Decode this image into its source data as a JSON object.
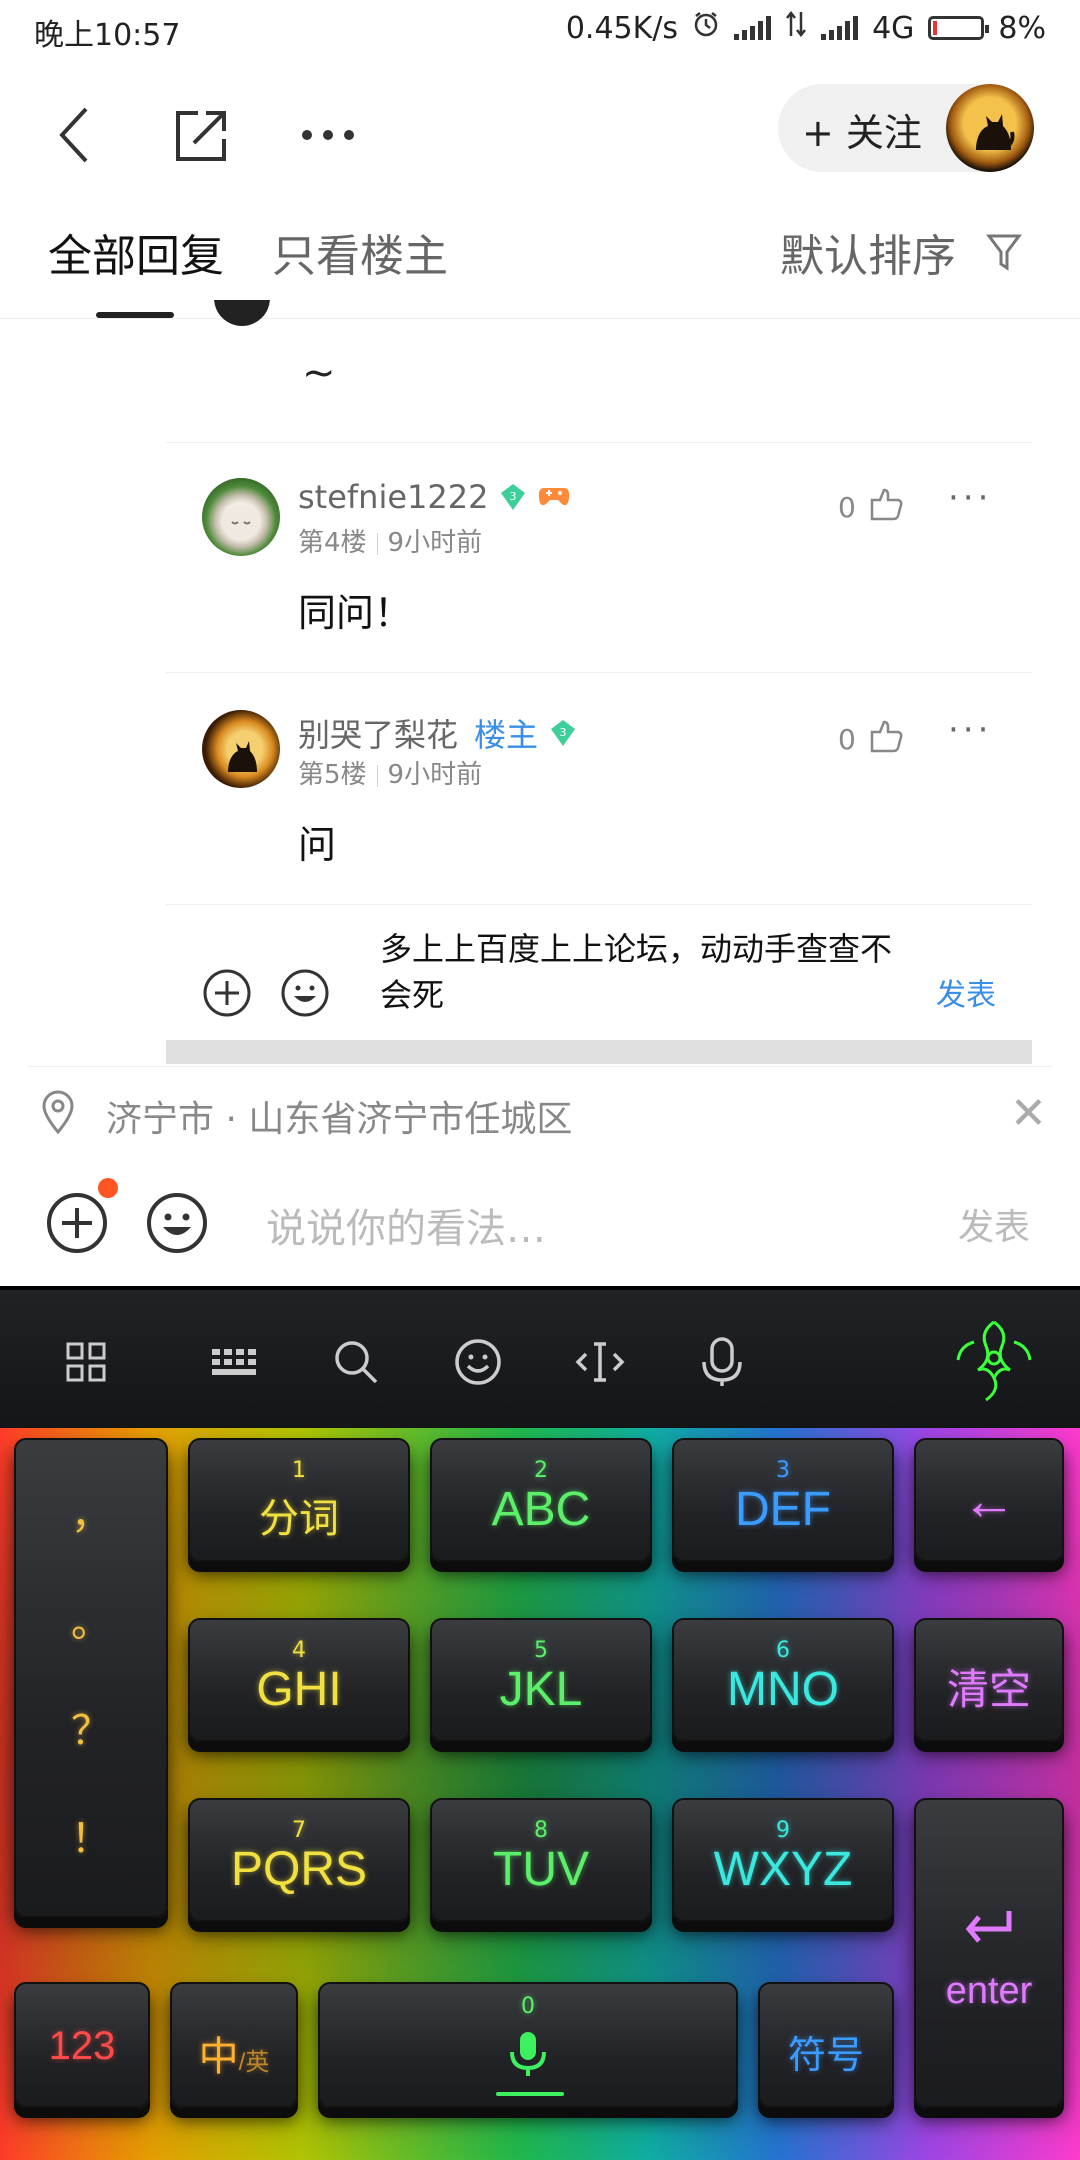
{
  "status_bar": {
    "time": "晚上10:57",
    "net_speed": "0.45K/s",
    "network_type": "4G",
    "battery": "8%",
    "battery_level": 0.08
  },
  "top_nav": {
    "follow_label": "+ 关注",
    "icons": [
      "back-icon",
      "share-icon",
      "more-icon"
    ]
  },
  "tabs": {
    "all_replies": "全部回复",
    "owner_only": "只看楼主",
    "sort": "默认排序"
  },
  "partial_reply": {
    "text": "~"
  },
  "replies": [
    {
      "username": "stefnie1222",
      "level": "3",
      "floor": "第4楼",
      "time": "9小时前",
      "likes": "0",
      "text": "同问！"
    },
    {
      "username": "别哭了梨花",
      "badge": "楼主",
      "level": "3",
      "floor": "第5楼",
      "time": "9小时前",
      "likes": "0",
      "text": "问"
    }
  ],
  "inner_reply": {
    "text": "多上上百度上上论坛，动动手查查不会死",
    "send_label": "发表"
  },
  "location": {
    "text": "济宁市 · 山东省济宁市任城区"
  },
  "main_input": {
    "placeholder": "说说你的看法…",
    "send_label": "发表"
  },
  "keyboard": {
    "toolbar_icons": [
      "grid-icon",
      "keyboard-icon",
      "search-icon",
      "emoji-icon",
      "cursor-icon",
      "mic-icon",
      "razer-logo-icon"
    ],
    "punctuation": [
      "，",
      "。",
      "？",
      "！"
    ],
    "keys": [
      {
        "num": "1",
        "label": "分词"
      },
      {
        "num": "2",
        "label": "ABC"
      },
      {
        "num": "3",
        "label": "DEF"
      },
      {
        "num": "4",
        "label": "GHI"
      },
      {
        "num": "5",
        "label": "JKL"
      },
      {
        "num": "6",
        "label": "MNO"
      },
      {
        "num": "7",
        "label": "PQRS"
      },
      {
        "num": "8",
        "label": "TUV"
      },
      {
        "num": "9",
        "label": "WXYZ"
      }
    ],
    "backspace": "←",
    "clear": "清空",
    "enter": "enter",
    "numeric": "123",
    "lang_main": "中",
    "lang_alt": "/英",
    "space_num": "0",
    "symbols": "符号"
  }
}
